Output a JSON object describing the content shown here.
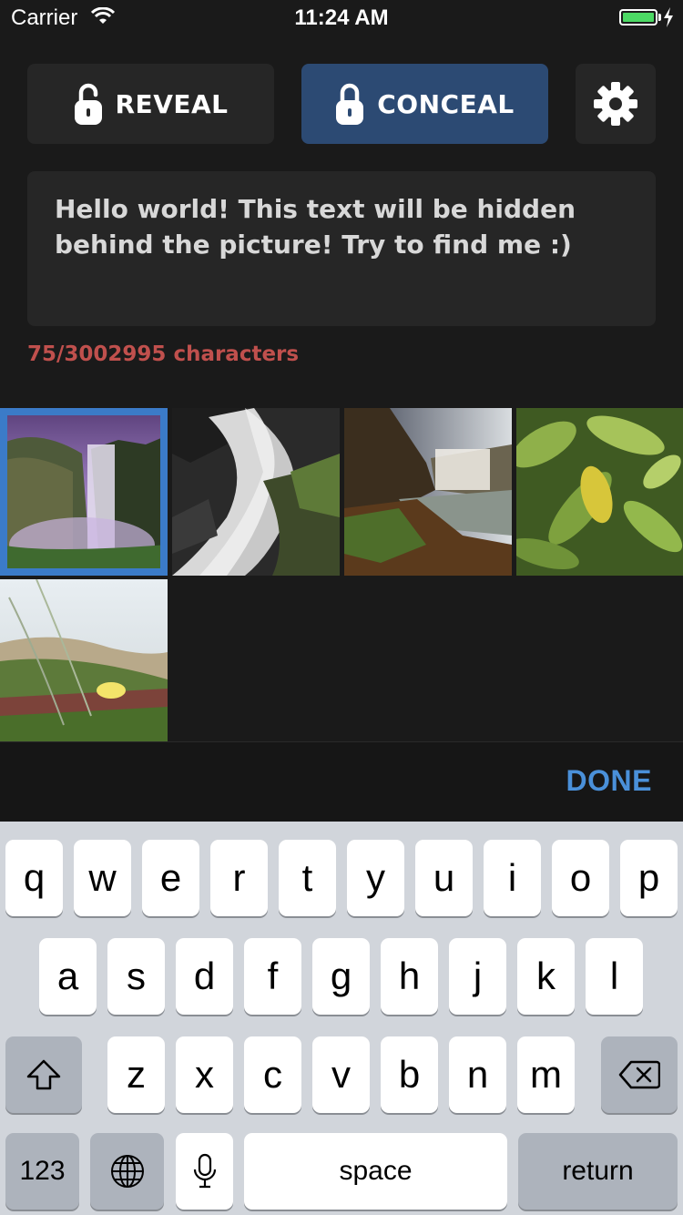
{
  "status_bar": {
    "carrier": "Carrier",
    "time": "11:24 AM",
    "battery_level": 1.0,
    "battery_color": "#4cd964"
  },
  "mode_buttons": {
    "reveal": {
      "label": "REVEAL",
      "icon": "unlock-icon"
    },
    "conceal": {
      "label": "CONCEAL",
      "icon": "lock-icon",
      "selected": true,
      "color": "#2c4a73"
    },
    "settings": {
      "icon": "gear-icon"
    }
  },
  "message": {
    "text": "Hello world! This text will be hidden behind the picture! Try to find me :)"
  },
  "char_count": {
    "text": "75/3002995 characters",
    "color": "#c0504d"
  },
  "photos": {
    "items": [
      {
        "name": "waterfall-purple-mist",
        "selected": true
      },
      {
        "name": "waterfall-rocks-bw",
        "selected": false
      },
      {
        "name": "waterfall-sunset-cliff",
        "selected": false
      },
      {
        "name": "green-leaves",
        "selected": false
      },
      {
        "name": "flowers-dune",
        "selected": false
      }
    ],
    "selection_color": "#3b7bc8"
  },
  "toolbar": {
    "done_label": "DONE",
    "accent": "#4a90d9"
  },
  "keyboard": {
    "row1": [
      "q",
      "w",
      "e",
      "r",
      "t",
      "y",
      "u",
      "i",
      "o",
      "p"
    ],
    "row2": [
      "a",
      "s",
      "d",
      "f",
      "g",
      "h",
      "j",
      "k",
      "l"
    ],
    "row3": [
      "z",
      "x",
      "c",
      "v",
      "b",
      "n",
      "m"
    ],
    "numbers_label": "123",
    "space_label": "space",
    "return_label": "return"
  }
}
